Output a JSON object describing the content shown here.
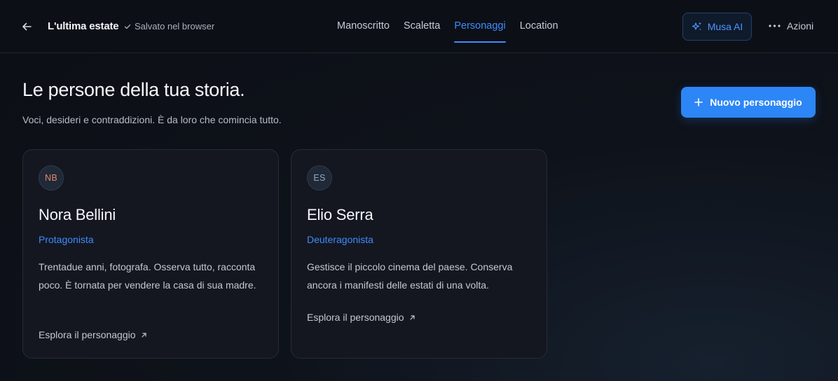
{
  "header": {
    "back_icon": "arrow-left-icon",
    "title": "L'ultima estate",
    "saved_status": "Salvato nel browser",
    "nav_tabs": [
      {
        "label": "Manoscritto",
        "active": false
      },
      {
        "label": "Scaletta",
        "active": false
      },
      {
        "label": "Personaggi",
        "active": true
      },
      {
        "label": "Location",
        "active": false
      }
    ],
    "musa_label": "Musa AI",
    "actions_label": "Azioni"
  },
  "hero": {
    "title": "Le persone della tua storia.",
    "subtitle": "Voci, desideri e contraddizioni. È da loro che comincia tutto.",
    "new_button_label": "Nuovo personaggio"
  },
  "characters": [
    {
      "initials": "NB",
      "initials_color": "#e8876a",
      "name": "Nora Bellini",
      "role": "Protagonista",
      "description": "Trentadue anni, fotografa. Osserva tutto, racconta poco. È tornata per vendere la casa di sua madre.",
      "link_label": "Esplora il personaggio"
    },
    {
      "initials": "ES",
      "initials_color": "#9aa7b8",
      "name": "Elio Serra",
      "role": "Deuteragonista",
      "description": "Gestisce il piccolo cinema del paese. Conserva ancora i manifesti delle estati di una volta.",
      "link_label": "Esplora il personaggio"
    }
  ],
  "colors": {
    "accent": "#3d8bff",
    "background": "#0e121a",
    "card": "#14171f"
  }
}
